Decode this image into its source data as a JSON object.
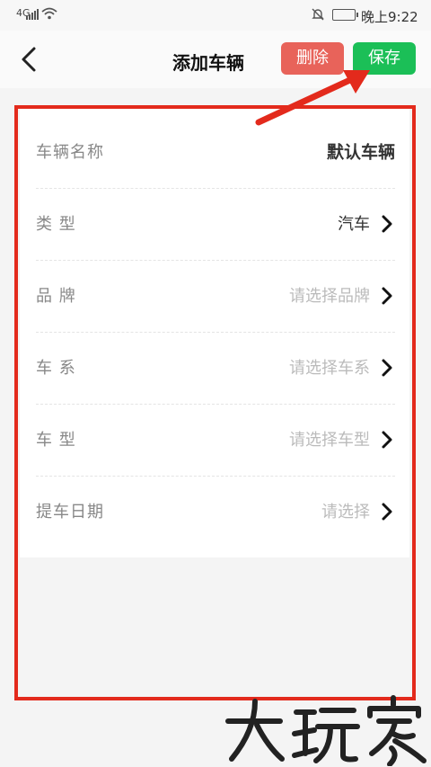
{
  "status_bar": {
    "network": "4G",
    "time": "晚上9:22",
    "icons": [
      "signal-icon",
      "wifi-icon",
      "notification-muted-icon",
      "battery-icon"
    ]
  },
  "nav": {
    "title": "添加车辆",
    "delete_label": "删除",
    "save_label": "保存",
    "delete_color": "#e8635a",
    "save_color": "#1bbf57"
  },
  "form": {
    "rows": [
      {
        "label": "车辆名称",
        "value": "默认车辆"
      },
      {
        "label": "类  型",
        "value": "汽车"
      },
      {
        "label": "品  牌",
        "placeholder": "请选择品牌"
      },
      {
        "label": "车  系",
        "placeholder": "请选择车系"
      },
      {
        "label": "车  型",
        "placeholder": "请选择车型"
      },
      {
        "label": "提车日期",
        "placeholder": "请选择"
      }
    ]
  },
  "annotation": {
    "highlight_color": "#e32a1c"
  },
  "watermark": {
    "text": "大玩家"
  }
}
